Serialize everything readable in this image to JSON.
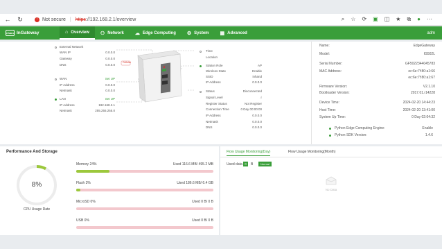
{
  "browser": {
    "security": "Not secure",
    "url_scheme": "https",
    "url_rest": "://192.168.2.1/overview"
  },
  "app": {
    "logo": "InGateway",
    "logo_mark": "inhand",
    "tabs": [
      "Overview",
      "Network",
      "Edge Computing",
      "System",
      "Advanced"
    ],
    "user": "adm"
  },
  "network": {
    "external": {
      "title": "External Network",
      "rows": [
        [
          "WAN IP",
          "0.0.0.0"
        ],
        [
          "Gateway",
          "0.0.0.0"
        ],
        [
          "DNS",
          "0.0.0.0"
        ]
      ]
    },
    "wan": {
      "title": "WAN",
      "status": "Set UP",
      "rows": [
        [
          "IP Address",
          "0.0.0.0"
        ],
        [
          "Netmask",
          "0.0.0.0"
        ]
      ]
    },
    "lan": {
      "title": "LAN",
      "status": "Set UP",
      "rows": [
        [
          "IP Address",
          "192.168.2.1"
        ],
        [
          "Netmask",
          "255.255.255.0"
        ]
      ]
    },
    "time": {
      "rows": [
        [
          "Time",
          ""
        ],
        [
          "Location",
          ""
        ]
      ]
    },
    "wlan": {
      "title": "Station Role",
      "role": "AP",
      "rows": [
        [
          "Wireless State",
          "Enable"
        ],
        [
          "SSID",
          "inhand"
        ],
        [
          "IP Address",
          "0.0.0.0"
        ]
      ]
    },
    "cellular": {
      "title": "Status",
      "status": "Disconnected",
      "rows": [
        [
          "Signal Level",
          ""
        ],
        [
          "Register Status",
          "Not Register"
        ],
        [
          "Connection Time",
          "0 Day 00:00:00"
        ],
        [
          "IP Address",
          "0.0.0.0"
        ],
        [
          "Netmask",
          "0.0.0.0"
        ],
        [
          "DNS",
          "0.0.0.0"
        ]
      ]
    },
    "cellular_tag": "Cellular"
  },
  "device": {
    "rows": [
      [
        "Name:",
        "EdgeGateway"
      ],
      [
        "Model:",
        "IG502L"
      ],
      [
        "Serial Number:",
        "GF5022344045783"
      ],
      [
        "MAC Address:",
        "ec:6e:7f:80:a1:66"
      ],
      [
        "",
        "ec:6e:7f:80:a1:67"
      ],
      [
        "Firmware Version:",
        "V2.1.10"
      ],
      [
        "Bootloader Version:",
        "2017.01.r14228"
      ],
      [
        "Device Time:",
        "2024-02-20 14:44:23"
      ],
      [
        "Host Time:",
        "2024-02-20 13:41:00"
      ],
      [
        "System Up Time:",
        "0 Day 02:04:32"
      ]
    ],
    "python_engine_label": "Python Edge Computing Engine:",
    "python_engine_value": "Enable",
    "python_sdk_label": "Python SDK Version:",
    "python_sdk_value": "1.4.6"
  },
  "performance": {
    "title": "Performance And Storage",
    "cpu_percent": 8,
    "cpu_text": "8%",
    "cpu_label": "CPU Usage Rate",
    "items": [
      {
        "name": "Memory 24%",
        "used": "Used 116.6 MB/ 495.2 MB",
        "fraction": 0.24
      },
      {
        "name": "Flash 3%",
        "used": "Used 186.6 MB/ 6.4 GB",
        "fraction": 0.03
      },
      {
        "name": "MicroSD 0%",
        "used": "Used 0 B/ 0 B",
        "fraction": 0.0
      },
      {
        "name": "USB 0%",
        "used": "Used 0 B/ 0 B",
        "fraction": 0.0
      }
    ]
  },
  "flow": {
    "tabs": [
      "Flow Usage Monitoring(Day)",
      "Flow Usage Monitoring(Month)"
    ],
    "used_label": "Used data",
    "used_value": "0",
    "used_unit": "B",
    "badge": "Normal",
    "empty": "No Data"
  },
  "colors": {
    "brand": "#3a9e3a",
    "bar_fill": "#9cc83c",
    "bar_track": "#f3c8cd"
  }
}
